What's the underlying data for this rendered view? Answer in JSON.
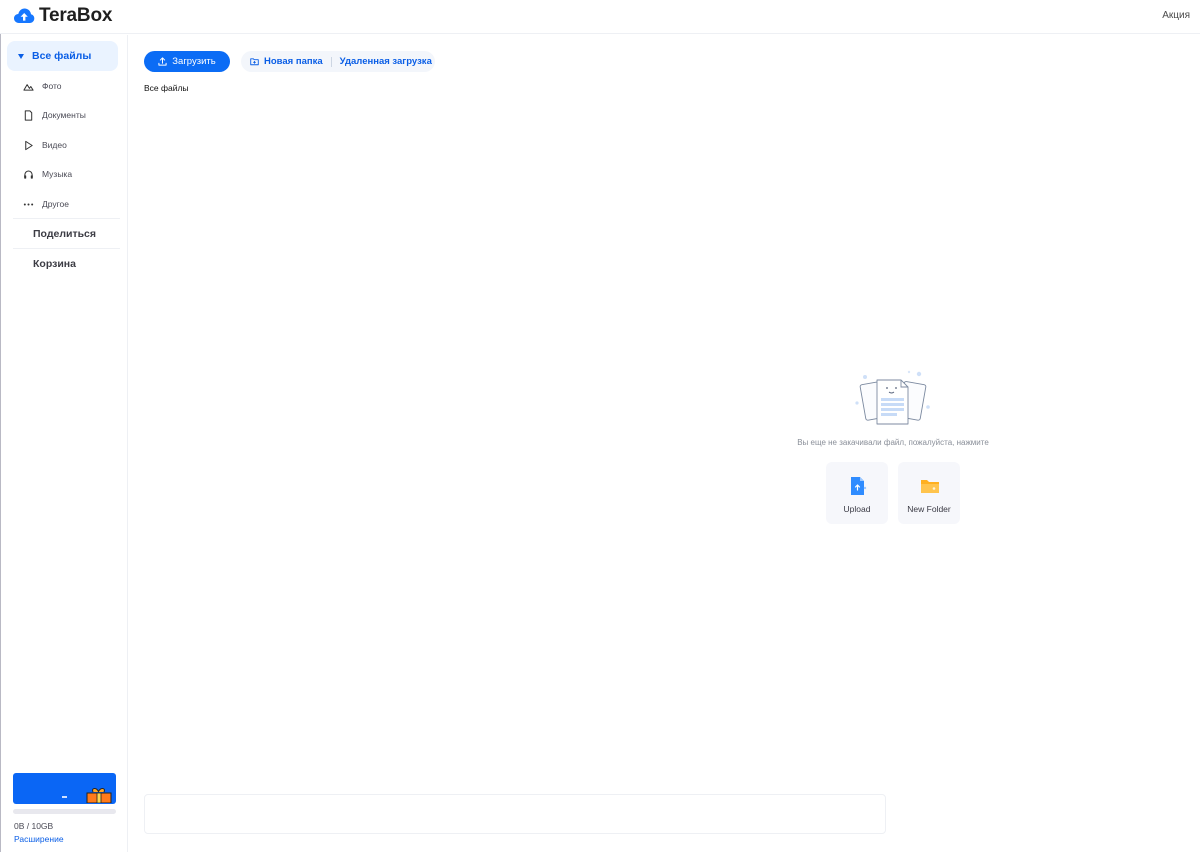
{
  "header": {
    "brand": "TeraBox",
    "promo_link": "Акция"
  },
  "sidebar": {
    "all_files": "Все файлы",
    "categories": [
      {
        "label": "Фото",
        "icon": "photo-icon"
      },
      {
        "label": "Документы",
        "icon": "document-icon"
      },
      {
        "label": "Видео",
        "icon": "video-play-icon"
      },
      {
        "label": "Музыка",
        "icon": "headphones-icon"
      },
      {
        "label": "Другое",
        "icon": "more-dots-icon"
      }
    ],
    "share": "Поделиться",
    "trash": "Корзина",
    "storage": {
      "used_text": "0B / 10GB",
      "used_fraction": 0,
      "expand_link": "Расширение"
    }
  },
  "toolbar": {
    "upload_label": "Загрузить",
    "new_folder_label": "Новая папка",
    "remote_upload_label": "Удаленная загрузка"
  },
  "breadcrumb": "Все файлы",
  "empty_state": {
    "message": "Вы еще не закачивали файл, пожалуйста, нажмите",
    "cards": [
      {
        "label": "Upload",
        "icon": "upload-file-icon"
      },
      {
        "label": "New Folder",
        "icon": "folder-icon"
      }
    ]
  },
  "colors": {
    "accent": "#0b6cf5",
    "active_bg": "#eaf3ff",
    "folder": "#ffb020"
  }
}
